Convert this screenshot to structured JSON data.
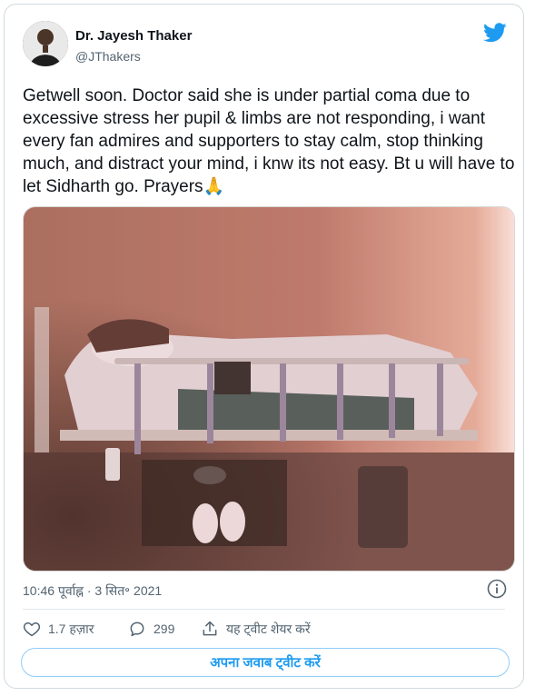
{
  "author": {
    "name": "Dr. Jayesh Thaker",
    "handle": "@JThakers"
  },
  "tweet": {
    "text": "Getwell soon. Doctor said she is under partial coma due to excessive stress her pupil & limbs are not responding, i want every fan admires and supporters to stay calm, stop thinking much, and distract your mind, i knw its not easy. Bt u will have to let Sidharth go. Prayers",
    "emoji": "🙏"
  },
  "timestamp": "10:46 पूर्वाह्न · 3 सित॰ 2021",
  "actions": {
    "likes": "1.7 हज़ार",
    "replies": "299",
    "share_label": "यह ट्वीट शेयर करें"
  },
  "reply_button_label": "अपना जवाब ट्वीट करें",
  "colors": {
    "twitter_blue": "#1d9bf0",
    "secondary_text": "#536471",
    "border": "#cfd9de"
  },
  "icons": [
    "twitter-bird-icon",
    "info-icon",
    "heart-icon",
    "reply-bubble-icon",
    "share-icon"
  ]
}
